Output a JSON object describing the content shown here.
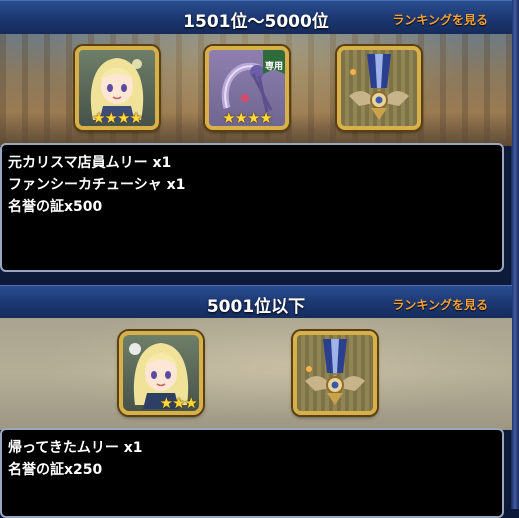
{
  "sections": [
    {
      "header": {
        "title": "1501位〜5000位",
        "link": "ランキングを見る"
      },
      "rewards": [
        {
          "icon": "character-portrait-icon",
          "stars": 4
        },
        {
          "icon": "fancy-katyusha-item-icon",
          "stars": 4,
          "badge": "専用"
        },
        {
          "icon": "honor-medal-icon"
        }
      ],
      "lines": [
        "元カリスマ店員ムリー x1",
        "ファンシーカチューシャ x1",
        "名誉の証x500"
      ]
    },
    {
      "header": {
        "title": "5001位以下",
        "link": "ランキングを見る"
      },
      "rewards": [
        {
          "icon": "character-portrait-icon",
          "stars": 3
        },
        {
          "icon": "honor-medal-icon"
        }
      ],
      "lines": [
        "帰ってきたムリー x1",
        "名誉の証x250"
      ]
    }
  ],
  "colors": {
    "header": "#1b3670",
    "link": "#f2a23a",
    "frame": "#d7b04a",
    "star": "#ffd93a"
  }
}
